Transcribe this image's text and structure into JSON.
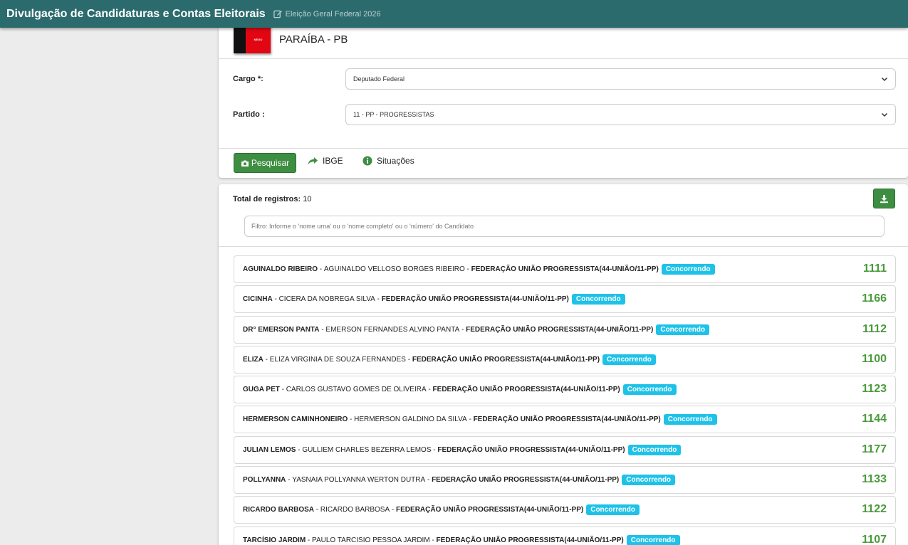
{
  "header": {
    "title": "Divulgação de Candidaturas e Contas Eleitorais",
    "election": "Eleição Geral Federal 2026",
    "color": "#2c6b6d"
  },
  "state": {
    "name": "PARAÍBA - PB",
    "flag_text": "NEGO"
  },
  "form": {
    "cargo_label": "Cargo *:",
    "cargo_value": "Deputado Federal",
    "partido_label": "Partido :",
    "partido_value": "11 - PP - PROGRESSISTAS"
  },
  "actions": {
    "search": "Pesquisar",
    "ibge": "IBGE",
    "situacoes": "Situações"
  },
  "results": {
    "total_label": "Total de registros:",
    "total_value": "10",
    "filter_placeholder": "Filtro: Informe o 'nome urna' ou o 'nome completo' ou o 'número' do Candidato",
    "candidates": [
      {
        "urna": "AGUINALDO RIBEIRO",
        "nome": "AGUINALDO VELLOSO BORGES RIBEIRO",
        "partido": "FEDERAÇÃO UNIÃO PROGRESSISTA(44-UNIÃO/11-PP)",
        "situacao": "Concorrendo",
        "numero": "1111"
      },
      {
        "urna": "CICINHA",
        "nome": "CICERA DA NOBREGA SILVA",
        "partido": "FEDERAÇÃO UNIÃO PROGRESSISTA(44-UNIÃO/11-PP)",
        "situacao": "Concorrendo",
        "numero": "1166"
      },
      {
        "urna": "DR° EMERSON PANTA",
        "nome": "EMERSON FERNANDES ALVINO PANTA",
        "partido": "FEDERAÇÃO UNIÃO PROGRESSISTA(44-UNIÃO/11-PP)",
        "situacao": "Concorrendo",
        "numero": "1112"
      },
      {
        "urna": "ELIZA",
        "nome": "ELIZA VIRGINIA DE SOUZA FERNANDES",
        "partido": "FEDERAÇÃO UNIÃO PROGRESSISTA(44-UNIÃO/11-PP)",
        "situacao": "Concorrendo",
        "numero": "1100"
      },
      {
        "urna": "GUGA PET",
        "nome": "CARLOS GUSTAVO GOMES DE OLIVEIRA",
        "partido": "FEDERAÇÃO UNIÃO PROGRESSISTA(44-UNIÃO/11-PP)",
        "situacao": "Concorrendo",
        "numero": "1123"
      },
      {
        "urna": "HERMERSON CAMINHONEIRO",
        "nome": "HERMERSON GALDINO DA SILVA",
        "partido": "FEDERAÇÃO UNIÃO PROGRESSISTA(44-UNIÃO/11-PP)",
        "situacao": "Concorrendo",
        "numero": "1144"
      },
      {
        "urna": "JULIAN LEMOS",
        "nome": "GULLIEM CHARLES BEZERRA LEMOS",
        "partido": "FEDERAÇÃO UNIÃO PROGRESSISTA(44-UNIÃO/11-PP)",
        "situacao": "Concorrendo",
        "numero": "1177"
      },
      {
        "urna": "POLLYANNA",
        "nome": "YASNAIA POLLYANNA WERTON DUTRA",
        "partido": "FEDERAÇÃO UNIÃO PROGRESSISTA(44-UNIÃO/11-PP)",
        "situacao": "Concorrendo",
        "numero": "1133"
      },
      {
        "urna": "RICARDO BARBOSA",
        "nome": "RICARDO BARBOSA",
        "partido": "FEDERAÇÃO UNIÃO PROGRESSISTA(44-UNIÃO/11-PP)",
        "situacao": "Concorrendo",
        "numero": "1122"
      },
      {
        "urna": "TARCÍSIO JARDIM",
        "nome": "PAULO TARCISIO PESSOA JARDIM",
        "partido": "FEDERAÇÃO UNIÃO PROGRESSISTA(44-UNIÃO/11-PP)",
        "situacao": "Concorrendo",
        "numero": "1107"
      }
    ]
  },
  "colors": {
    "accent_green": "#3e8e41",
    "number_green": "#4a9a3c",
    "badge_cyan": "#1ec2e8"
  },
  "icons": {
    "edit": "edit-icon",
    "camera": "camera-icon",
    "share": "share-arrow-icon",
    "info": "info-icon",
    "download": "download-icon",
    "chevron": "chevron-down-icon"
  }
}
